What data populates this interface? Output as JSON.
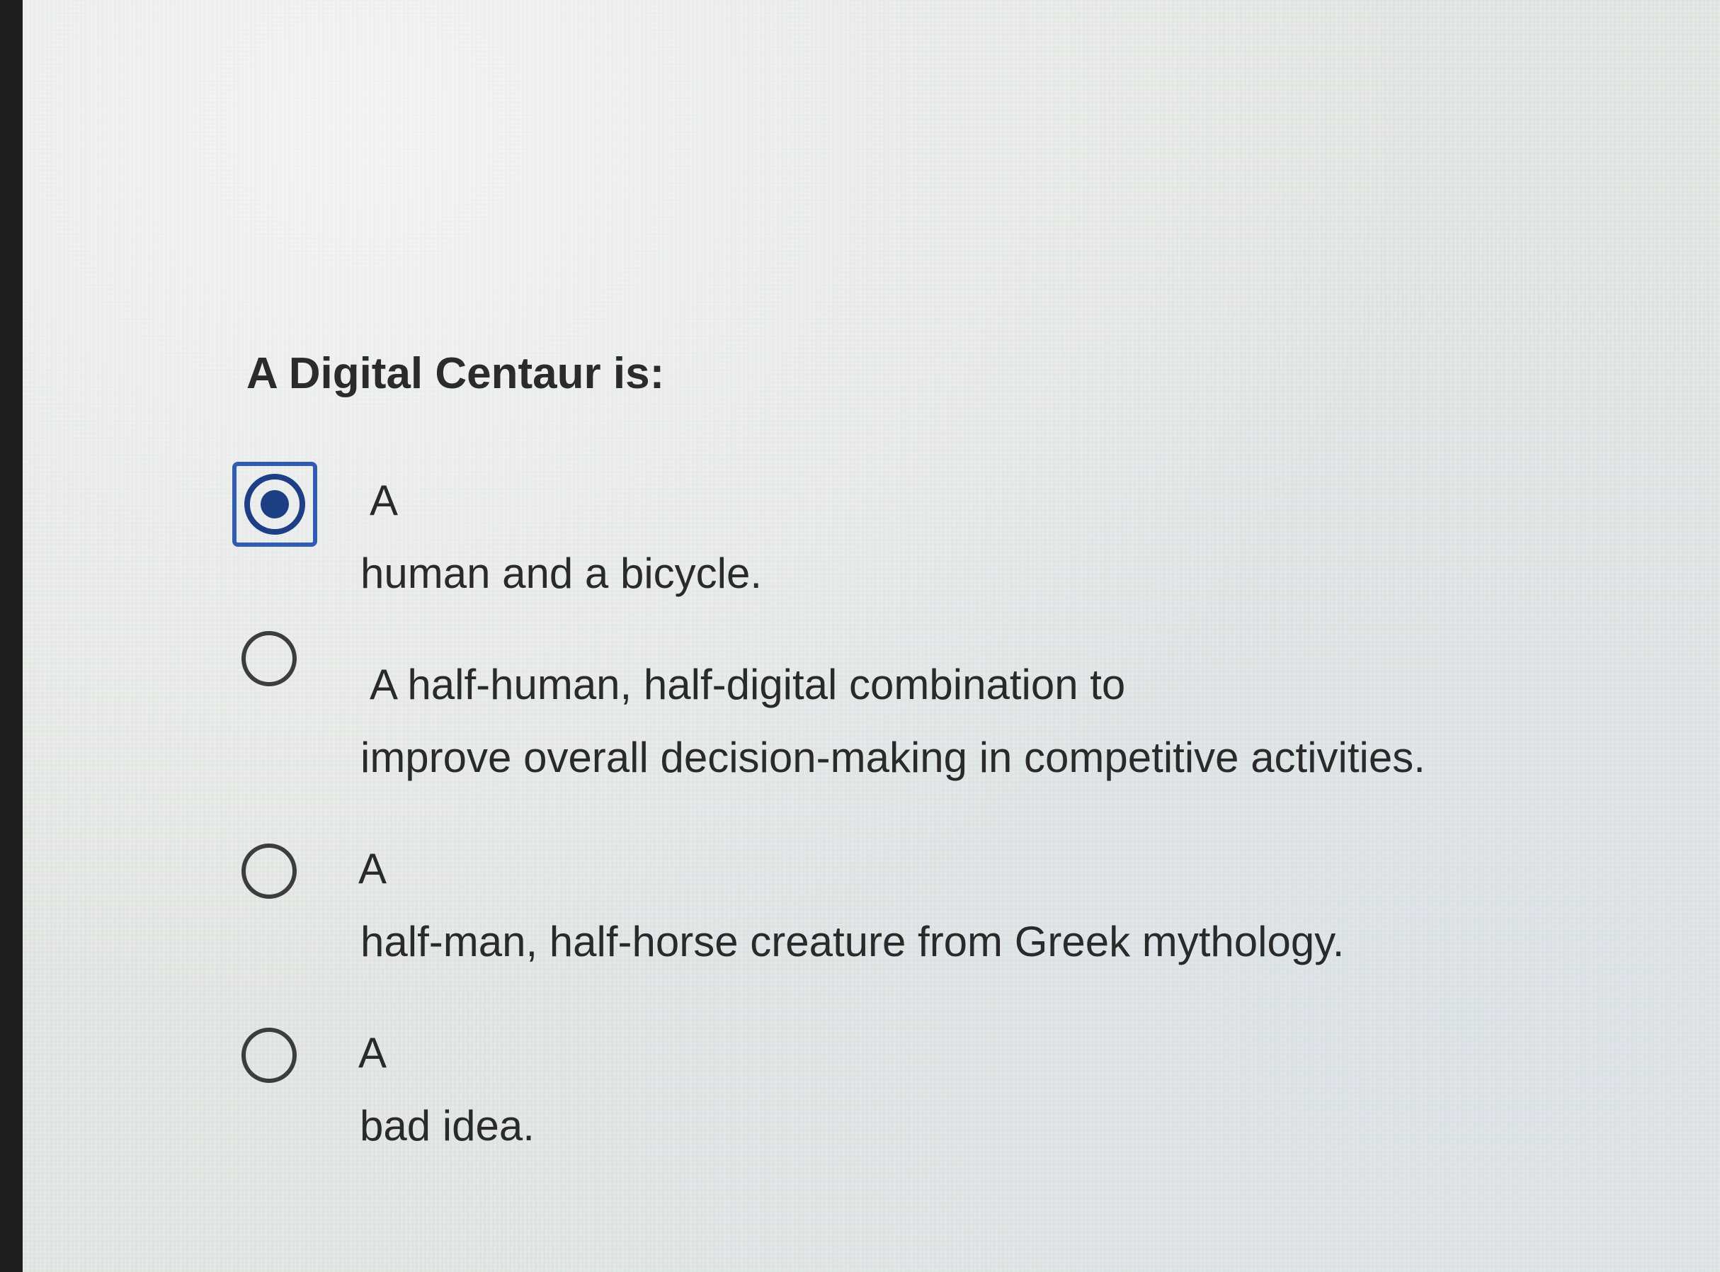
{
  "question": {
    "title": "A Digital Centaur is:"
  },
  "options": [
    {
      "line1": "A",
      "line2": "human and a bicycle.",
      "selected": true
    },
    {
      "line1": "A half-human, half-digital combination to",
      "line2": "improve overall decision-making in competitive activities.",
      "selected": false
    },
    {
      "line1": "A",
      "line2": "half-man, half-horse creature from Greek mythology.",
      "selected": false
    },
    {
      "line1": "A",
      "line2": "bad idea.",
      "selected": false
    }
  ],
  "colors": {
    "accent": "#1d3f86",
    "focus_ring": "#2f5db5",
    "text": "#2a2a2a"
  }
}
